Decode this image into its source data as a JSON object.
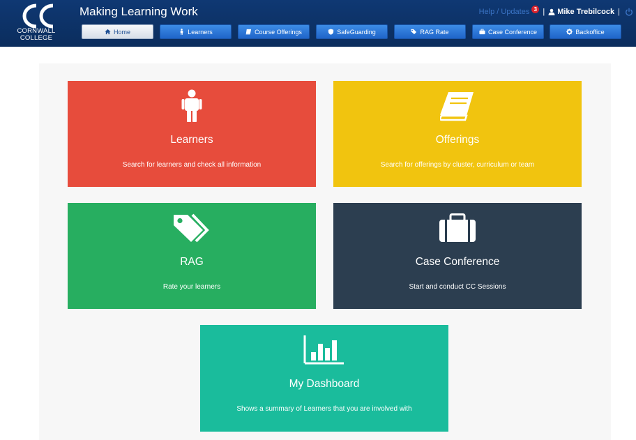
{
  "header": {
    "logo_text_1": "CORNWALL",
    "logo_text_2": "COLLEGE",
    "title": "Making Learning Work",
    "help_link": "Help / Updates",
    "badge_count": "3",
    "separator": "|",
    "user_name": "Mike Trebilcock",
    "user_icon": "user-icon",
    "power_icon": "power-icon"
  },
  "nav": [
    {
      "label": "Home",
      "icon": "home-icon",
      "active": true
    },
    {
      "label": "Learners",
      "icon": "person-icon"
    },
    {
      "label": "Course Offerings",
      "icon": "book-icon"
    },
    {
      "label": "SafeGuarding",
      "icon": "shield-icon"
    },
    {
      "label": "RAG Rate",
      "icon": "tags-icon"
    },
    {
      "label": "Case Conference",
      "icon": "briefcase-icon"
    },
    {
      "label": "Backoffice",
      "icon": "gear-icon"
    }
  ],
  "tiles": [
    {
      "title": "Learners",
      "description": "Search for learners and check all information",
      "icon": "person-icon",
      "color": "#e74c3c"
    },
    {
      "title": "Offerings",
      "description": "Search for offerings by cluster, curriculum or team",
      "icon": "book-icon",
      "color": "#f1c40f"
    },
    {
      "title": "RAG",
      "description": "Rate your learners",
      "icon": "tags-icon",
      "color": "#27ae60"
    },
    {
      "title": "Case Conference",
      "description": "Start and conduct CC Sessions",
      "icon": "briefcase-icon",
      "color": "#2c3e50"
    },
    {
      "title": "My Dashboard",
      "description": "Shows a summary of Learners that you are involved with",
      "icon": "bar-chart-icon",
      "color": "#1abc9c"
    }
  ],
  "colors": {
    "header_bg": "#0b2d5d",
    "nav_button": "#1f65c9",
    "content_bg": "#f7f7f7"
  }
}
